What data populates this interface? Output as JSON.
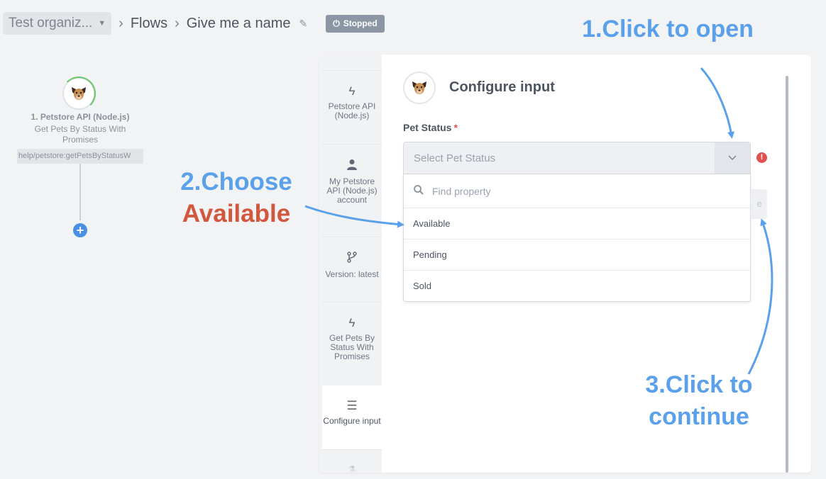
{
  "breadcrumb": {
    "organization": "Test organiz...",
    "flows": "Flows",
    "flow_name": "Give me a name",
    "status": "Stopped"
  },
  "node": {
    "title": "1. Petstore API (Node.js)",
    "subtitle": "Get Pets By Status With Promises",
    "path": "help/petstore:getPetsByStatusW"
  },
  "steps": [
    {
      "icon": "lightning-icon",
      "label": "Petstore API (Node.js)"
    },
    {
      "icon": "user-icon",
      "label": "My Petstore API (Node.js) account"
    },
    {
      "icon": "branch-icon",
      "label": "Version: latest"
    },
    {
      "icon": "lightning-icon",
      "label": "Get Pets By Status With Promises"
    },
    {
      "icon": "menu-icon",
      "label": "Configure input"
    }
  ],
  "configure": {
    "title": "Configure input",
    "field_label": "Pet Status",
    "required_mark": "*",
    "select_placeholder": "Select Pet Status",
    "search_placeholder": "Find property",
    "options": [
      "Available",
      "Pending",
      "Sold"
    ]
  },
  "annotations": {
    "step1": "1.Click to open",
    "step2_line1": "2.Choose",
    "step2_line2": "Available",
    "step3_line1": "3.Click to",
    "step3_line2": "continue"
  },
  "colors": {
    "accent_blue": "#5ba0ea",
    "accent_red": "#d2573c",
    "status_badge": "#8c96a5",
    "error": "#e05252"
  }
}
